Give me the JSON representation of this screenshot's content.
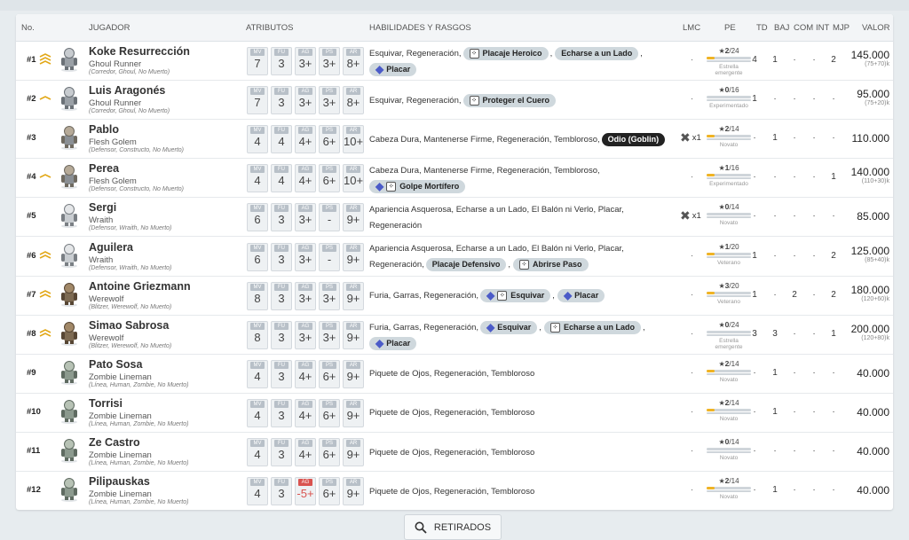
{
  "headers": {
    "no": "No.",
    "player": "JUGADOR",
    "attributes": "ATRIBUTOS",
    "skills": "HABILIDADES Y RASGOS",
    "lmc": "LMC",
    "pe": "PE",
    "td": "TD",
    "baj": "BAJ",
    "com": "COM",
    "int": "INT",
    "mjp": "MJP",
    "value": "VALOR"
  },
  "stat_labels": [
    "MV",
    "FU",
    "AG",
    "PS",
    "AR"
  ],
  "players": [
    {
      "num": "#1",
      "arrow": "triple-up-icon",
      "sprite": "ghoul-runner-sprite",
      "name": "Koke Resurrección",
      "position": "Ghoul Runner",
      "keywords": "(Corredor, Ghoul, No Muerto)",
      "stats": [
        "7",
        "3",
        "3+",
        "3+",
        "8+"
      ],
      "bad_stat": -1,
      "skills": [
        {
          "kind": "text",
          "text": "Esquivar, Regeneración,"
        },
        {
          "kind": "chip",
          "text": "Placaje Heroico",
          "icons": [
            "dice"
          ]
        },
        {
          "kind": "comma",
          "text": ","
        },
        {
          "kind": "chip",
          "text": "Echarse a un Lado",
          "icons": []
        },
        {
          "kind": "comma",
          "text": ","
        },
        {
          "kind": "chip",
          "text": "Placar",
          "icons": [
            "gem"
          ]
        }
      ],
      "lmc": "·",
      "lmc_icon": false,
      "pe_stars": "2",
      "pe_frac": "/24",
      "pe_fill": 0.083,
      "pe_level": "Estrella emergente",
      "td": "4",
      "baj": "1",
      "com": "·",
      "int": "·",
      "mjp": "2",
      "value": "145.000",
      "value_sub": "(75+70)k"
    },
    {
      "num": "#2",
      "arrow": "single-up-icon",
      "sprite": "ghoul-runner-sprite",
      "name": "Luis Aragonés",
      "position": "Ghoul Runner",
      "keywords": "(Corredor, Ghoul, No Muerto)",
      "stats": [
        "7",
        "3",
        "3+",
        "3+",
        "8+"
      ],
      "bad_stat": -1,
      "skills": [
        {
          "kind": "text",
          "text": "Esquivar, Regeneración,"
        },
        {
          "kind": "chip",
          "text": "Proteger el Cuero",
          "icons": [
            "dice"
          ]
        }
      ],
      "lmc": "·",
      "lmc_icon": false,
      "pe_stars": "0",
      "pe_frac": "/16",
      "pe_fill": 0.0,
      "pe_level": "Experimentado",
      "td": "1",
      "baj": "·",
      "com": "·",
      "int": "·",
      "mjp": "·",
      "value": "95.000",
      "value_sub": "(75+20)k"
    },
    {
      "num": "#3",
      "arrow": "",
      "sprite": "flesh-golem-sprite",
      "name": "Pablo",
      "position": "Flesh Golem",
      "keywords": "(Defensor, Constructo, No Muerto)",
      "stats": [
        "4",
        "4",
        "4+",
        "6+",
        "10+"
      ],
      "bad_stat": -1,
      "skills": [
        {
          "kind": "text",
          "text": "Cabeza Dura, Mantenerse Firme, Regeneración, Tembloroso,"
        },
        {
          "kind": "chip-dark",
          "text": "Odio (Goblin)",
          "icons": []
        }
      ],
      "lmc": "x1",
      "lmc_icon": true,
      "pe_stars": "2",
      "pe_frac": "/14",
      "pe_fill": 0.14,
      "pe_level": "Novato",
      "td": "·",
      "baj": "1",
      "com": "·",
      "int": "·",
      "mjp": "·",
      "value": "110.000",
      "value_sub": ""
    },
    {
      "num": "#4",
      "arrow": "single-up-icon",
      "sprite": "flesh-golem-sprite",
      "name": "Perea",
      "position": "Flesh Golem",
      "keywords": "(Defensor, Constructo, No Muerto)",
      "stats": [
        "4",
        "4",
        "4+",
        "6+",
        "10+"
      ],
      "bad_stat": -1,
      "skills": [
        {
          "kind": "text",
          "text": "Cabeza Dura, Mantenerse Firme, Regeneración, Tembloroso,"
        },
        {
          "kind": "chip",
          "text": "Golpe Mortífero",
          "icons": [
            "gem",
            "dice"
          ]
        }
      ],
      "lmc": "·",
      "lmc_icon": false,
      "pe_stars": "1",
      "pe_frac": "/16",
      "pe_fill": 0.06,
      "pe_level": "Experimentado",
      "td": "·",
      "baj": "·",
      "com": "·",
      "int": "·",
      "mjp": "1",
      "value": "140.000",
      "value_sub": "(110+30)k"
    },
    {
      "num": "#5",
      "arrow": "",
      "sprite": "wraith-sprite",
      "name": "Sergi",
      "position": "Wraith",
      "keywords": "(Defensor, Wraith, No Muerto)",
      "stats": [
        "6",
        "3",
        "3+",
        "-",
        "9+"
      ],
      "bad_stat": -1,
      "skills": [
        {
          "kind": "text",
          "text": "Apariencia Asquerosa, Echarse a un Lado, El Balón ni Verlo, Placar,"
        },
        {
          "kind": "text",
          "text": "Regeneración"
        }
      ],
      "lmc": "x1",
      "lmc_icon": true,
      "pe_stars": "0",
      "pe_frac": "/14",
      "pe_fill": 0.0,
      "pe_level": "Novato",
      "td": "·",
      "baj": "·",
      "com": "·",
      "int": "·",
      "mjp": "·",
      "value": "85.000",
      "value_sub": ""
    },
    {
      "num": "#6",
      "arrow": "double-up-icon",
      "sprite": "wraith-sprite",
      "name": "Aguilera",
      "position": "Wraith",
      "keywords": "(Defensor, Wraith, No Muerto)",
      "stats": [
        "6",
        "3",
        "3+",
        "-",
        "9+"
      ],
      "bad_stat": -1,
      "skills": [
        {
          "kind": "text",
          "text": "Apariencia Asquerosa, Echarse a un Lado, El Balón ni Verlo, Placar,"
        },
        {
          "kind": "text",
          "text": "Regeneración,"
        },
        {
          "kind": "chip",
          "text": "Placaje Defensivo",
          "icons": []
        },
        {
          "kind": "comma",
          "text": ","
        },
        {
          "kind": "chip",
          "text": "Abrirse Paso",
          "icons": [
            "dice"
          ]
        }
      ],
      "lmc": "·",
      "lmc_icon": false,
      "pe_stars": "1",
      "pe_frac": "/20",
      "pe_fill": 0.05,
      "pe_level": "Veterano",
      "td": "1",
      "baj": "·",
      "com": "·",
      "int": "·",
      "mjp": "2",
      "value": "125.000",
      "value_sub": "(85+40)k"
    },
    {
      "num": "#7",
      "arrow": "double-up-icon",
      "sprite": "werewolf-sprite",
      "name": "Antoine Griezmann",
      "position": "Werewolf",
      "keywords": "(Blitzer, Werewolf, No Muerto)",
      "stats": [
        "8",
        "3",
        "3+",
        "3+",
        "9+"
      ],
      "bad_stat": -1,
      "skills": [
        {
          "kind": "text",
          "text": "Furia, Garras, Regeneración,"
        },
        {
          "kind": "chip",
          "text": "Esquivar",
          "icons": [
            "gem",
            "dice"
          ]
        },
        {
          "kind": "comma",
          "text": ","
        },
        {
          "kind": "chip",
          "text": "Placar",
          "icons": [
            "gem"
          ]
        }
      ],
      "lmc": "·",
      "lmc_icon": false,
      "pe_stars": "3",
      "pe_frac": "/20",
      "pe_fill": 0.15,
      "pe_level": "Veterano",
      "td": "1",
      "baj": "·",
      "com": "2",
      "int": "·",
      "mjp": "2",
      "value": "180.000",
      "value_sub": "(120+60)k"
    },
    {
      "num": "#8",
      "arrow": "double-up-icon",
      "sprite": "werewolf-sprite",
      "name": "Simao Sabrosa",
      "position": "Werewolf",
      "keywords": "(Blitzer, Werewolf, No Muerto)",
      "stats": [
        "8",
        "3",
        "3+",
        "3+",
        "9+"
      ],
      "bad_stat": -1,
      "skills": [
        {
          "kind": "text",
          "text": "Furia, Garras, Regeneración,"
        },
        {
          "kind": "chip",
          "text": "Esquivar",
          "icons": [
            "gem"
          ]
        },
        {
          "kind": "comma",
          "text": ","
        },
        {
          "kind": "chip",
          "text": "Echarse a un Lado",
          "icons": [
            "dice"
          ]
        },
        {
          "kind": "comma",
          "text": ","
        },
        {
          "kind": "chip",
          "text": "Placar",
          "icons": [
            "gem"
          ]
        }
      ],
      "lmc": "·",
      "lmc_icon": false,
      "pe_stars": "0",
      "pe_frac": "/24",
      "pe_fill": 0.0,
      "pe_level": "Estrella emergente",
      "td": "3",
      "baj": "3",
      "com": "·",
      "int": "·",
      "mjp": "1",
      "value": "200.000",
      "value_sub": "(120+80)k"
    },
    {
      "num": "#9",
      "arrow": "",
      "sprite": "zombie-sprite",
      "name": "Pato Sosa",
      "position": "Zombie Lineman",
      "keywords": "(Línea, Human, Zombie, No Muerto)",
      "stats": [
        "4",
        "3",
        "4+",
        "6+",
        "9+"
      ],
      "bad_stat": -1,
      "skills": [
        {
          "kind": "text",
          "text": "Piquete de Ojos, Regeneración, Tembloroso"
        }
      ],
      "lmc": "·",
      "lmc_icon": false,
      "pe_stars": "2",
      "pe_frac": "/14",
      "pe_fill": 0.14,
      "pe_level": "Novato",
      "td": "·",
      "baj": "1",
      "com": "·",
      "int": "·",
      "mjp": "·",
      "value": "40.000",
      "value_sub": ""
    },
    {
      "num": "#10",
      "arrow": "",
      "sprite": "zombie-sprite",
      "name": "Torrisi",
      "position": "Zombie Lineman",
      "keywords": "(Línea, Human, Zombie, No Muerto)",
      "stats": [
        "4",
        "3",
        "4+",
        "6+",
        "9+"
      ],
      "bad_stat": -1,
      "skills": [
        {
          "kind": "text",
          "text": "Piquete de Ojos, Regeneración, Tembloroso"
        }
      ],
      "lmc": "·",
      "lmc_icon": false,
      "pe_stars": "2",
      "pe_frac": "/14",
      "pe_fill": 0.14,
      "pe_level": "Novato",
      "td": "·",
      "baj": "1",
      "com": "·",
      "int": "·",
      "mjp": "·",
      "value": "40.000",
      "value_sub": ""
    },
    {
      "num": "#11",
      "arrow": "",
      "sprite": "zombie-sprite",
      "name": "Ze Castro",
      "position": "Zombie Lineman",
      "keywords": "(Línea, Human, Zombie, No Muerto)",
      "stats": [
        "4",
        "3",
        "4+",
        "6+",
        "9+"
      ],
      "bad_stat": -1,
      "skills": [
        {
          "kind": "text",
          "text": "Piquete de Ojos, Regeneración, Tembloroso"
        }
      ],
      "lmc": "·",
      "lmc_icon": false,
      "pe_stars": "0",
      "pe_frac": "/14",
      "pe_fill": 0.0,
      "pe_level": "Novato",
      "td": "·",
      "baj": "·",
      "com": "·",
      "int": "·",
      "mjp": "·",
      "value": "40.000",
      "value_sub": ""
    },
    {
      "num": "#12",
      "arrow": "",
      "sprite": "zombie-sprite",
      "name": "Pilipauskas",
      "position": "Zombie Lineman",
      "keywords": "(Línea, Human, Zombie, No Muerto)",
      "stats": [
        "4",
        "3",
        "-5+",
        "6+",
        "9+"
      ],
      "bad_stat": 2,
      "skills": [
        {
          "kind": "text",
          "text": "Piquete de Ojos, Regeneración, Tembloroso"
        }
      ],
      "lmc": "·",
      "lmc_icon": false,
      "pe_stars": "2",
      "pe_frac": "/14",
      "pe_fill": 0.14,
      "pe_level": "Novato",
      "td": "·",
      "baj": "1",
      "com": "·",
      "int": "·",
      "mjp": "·",
      "value": "40.000",
      "value_sub": ""
    }
  ],
  "retired_button": "RETIRADOS",
  "colors": {
    "chip": "#cfd8dd",
    "gem": "#4b5bc8",
    "star_bar": "#f0b323",
    "arrow": "#e2a818",
    "bad": "#d9534f"
  }
}
